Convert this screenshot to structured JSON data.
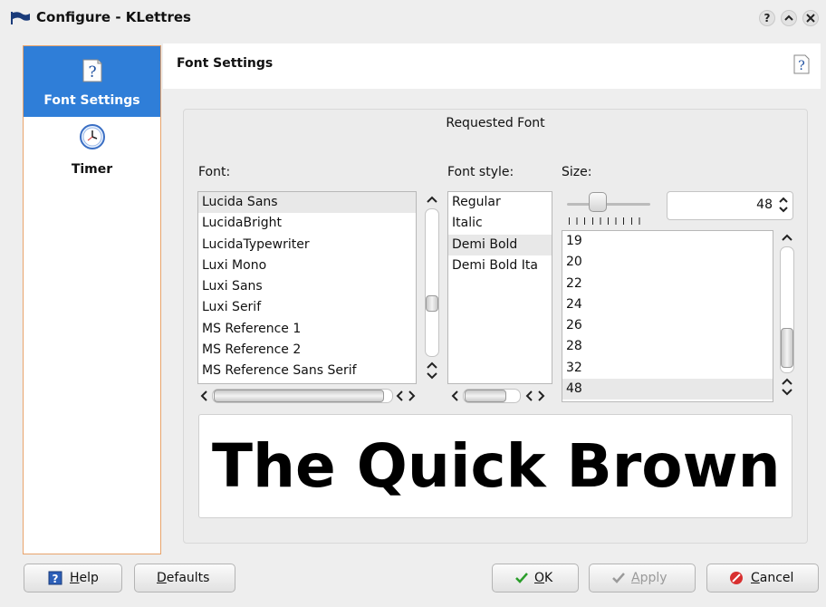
{
  "window": {
    "title": "Configure - KLettres",
    "controls": [
      "?",
      "^",
      "x"
    ]
  },
  "sidebar": {
    "items": [
      {
        "label": "Font Settings",
        "icon": "help-question-icon",
        "selected": true
      },
      {
        "label": "Timer",
        "icon": "clock-icon",
        "selected": false
      }
    ]
  },
  "page": {
    "title": "Font Settings"
  },
  "font_chooser": {
    "group_title": "Requested Font",
    "font_label": "Font:",
    "style_label": "Font style:",
    "size_label": "Size:",
    "fonts": [
      "Lucida Sans",
      "LucidaBright",
      "LucidaTypewriter",
      "Luxi Mono",
      "Luxi Sans",
      "Luxi Serif",
      "MS Reference 1",
      "MS Reference 2",
      "MS Reference Sans Serif"
    ],
    "selected_font": "Lucida Sans",
    "styles": [
      "Regular",
      "Italic",
      "Demi Bold",
      "Demi Bold Ita"
    ],
    "selected_style": "Demi Bold",
    "sizes": [
      "19",
      "20",
      "22",
      "24",
      "26",
      "28",
      "32",
      "48"
    ],
    "selected_size": "48",
    "size_value": "48",
    "preview_text": "The Quick Brown"
  },
  "buttons": {
    "help_prefix": "",
    "help_mnemonic": "H",
    "help_rest": "elp",
    "defaults_mnemonic": "D",
    "defaults_rest": "efaults",
    "ok_mnemonic": "O",
    "ok_rest": "K",
    "apply_mnemonic": "A",
    "apply_rest": "pply",
    "cancel_mnemonic": "C",
    "cancel_rest": "ancel"
  },
  "colors": {
    "selection": "#2f7ed8",
    "sidebar_border": "#e8a36b",
    "ok_check": "#2a9d2a",
    "cancel_red": "#d83030"
  }
}
